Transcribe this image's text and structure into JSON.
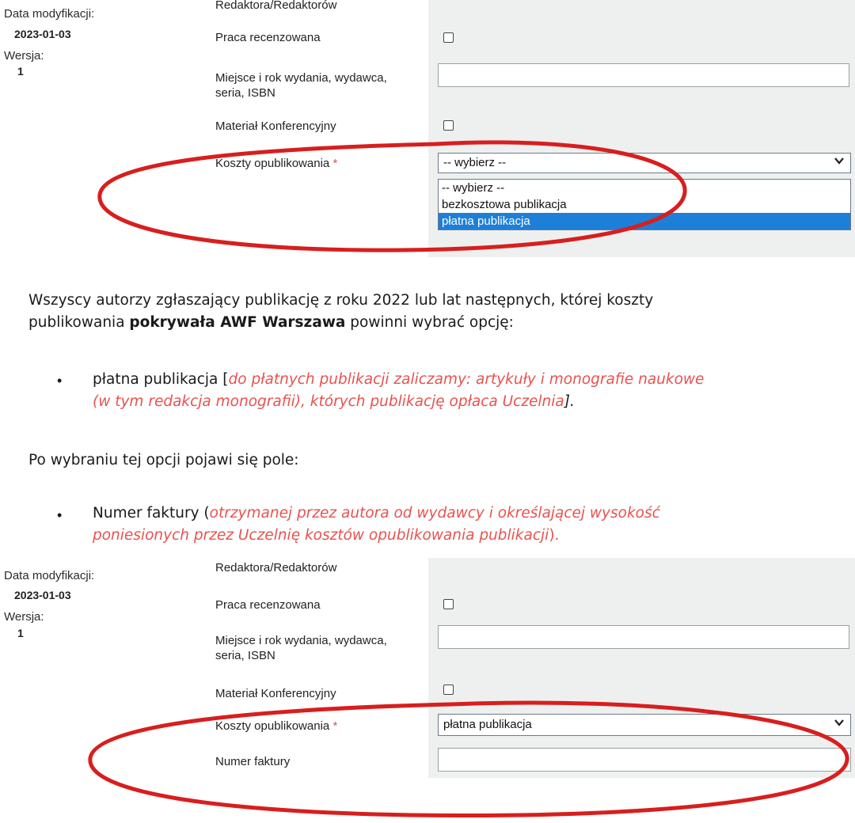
{
  "panel1": {
    "meta": {
      "date_label": "Data modyfikacji:",
      "date_value": "2023-01-03",
      "version_label": "Wersja:",
      "version_value": "1"
    },
    "fields": {
      "editors_label": "Redaktora/Redaktorów",
      "peer_reviewed_label": "Praca recenzowana",
      "place_year_label_line1": "Miejsce i rok wydania, wydawca,",
      "place_year_label_line2": "seria, ISBN",
      "conference_label": "Materiał Konferencyjny",
      "costs_label": "Koszty opublikowania",
      "required_mark": "*"
    },
    "select": {
      "value": "-- wybierz --",
      "options": [
        "-- wybierz --",
        "bezkosztowa publikacja",
        "płatna publikacja"
      ],
      "highlighted": "płatna publikacja"
    }
  },
  "text": {
    "para1_line1": "Wszyscy autorzy zgłaszający publikację z roku 2022 lub lat następnych, której koszty",
    "para1_line2_pre": "publikowania ",
    "para1_line2_bold": "pokrywała AWF Warszawa",
    "para1_line2_post": " powinni wybrać opcję:",
    "bullet1_prefix": "płatna publikacja [",
    "bullet1_red_line1": "do płatnych publikacji zaliczamy: artykuły i monografie naukowe",
    "bullet1_red_line2": "(w tym redakcja monografii), których publikację opłaca Uczelnia",
    "bullet1_suffix": "].",
    "para2": "Po wybraniu tej opcji pojawi się pole:",
    "bullet2_prefix": "Numer faktury (",
    "bullet2_red_line1": "otrzymanej przez autora od wydawcy i określającej wysokość",
    "bullet2_red_line2": "poniesionych przez Uczelnię kosztów opublikowania publikacji",
    "bullet2_suffix": ")."
  },
  "panel2": {
    "meta": {
      "date_label": "Data modyfikacji:",
      "date_value": "2023-01-03",
      "version_label": "Wersja:",
      "version_value": "1"
    },
    "fields": {
      "editors_label": "Redaktora/Redaktorów",
      "peer_reviewed_label": "Praca recenzowana",
      "place_year_label_line1": "Miejsce i rok wydania, wydawca,",
      "place_year_label_line2": "seria, ISBN",
      "conference_label": "Materiał Konferencyjny",
      "costs_label": "Koszty opublikowania",
      "required_mark": "*",
      "invoice_label": "Numer faktury"
    },
    "select": {
      "value": "płatna publikacja"
    }
  },
  "icons": {
    "select_chevron": "chevron-down-icon",
    "bullet": "bullet-dot"
  },
  "colors": {
    "annotation_red": "#d81e1e",
    "highlight_blue": "#1e7fd8",
    "note_red": "#e8524f",
    "panel_bg": "#eef0ef"
  }
}
